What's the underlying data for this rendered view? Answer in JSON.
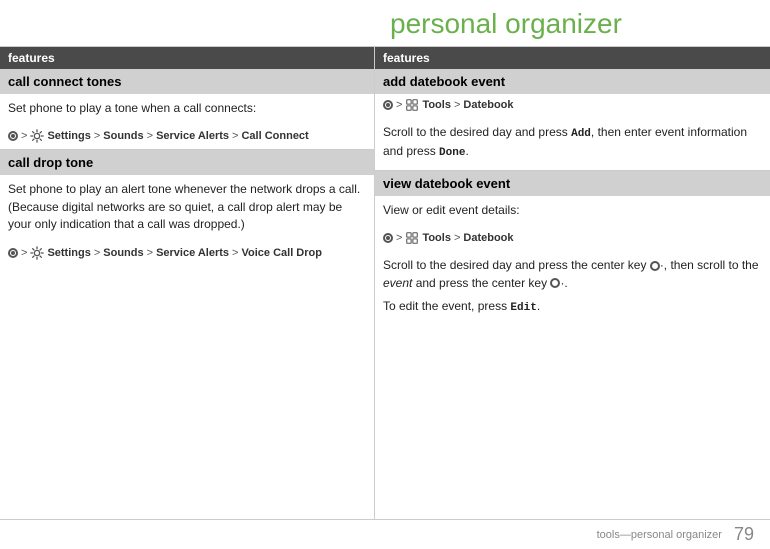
{
  "page": {
    "title": "personal organizer",
    "footer_text": "tools—personal organizer",
    "page_number": "79"
  },
  "left_panel": {
    "header": "features",
    "sections": [
      {
        "id": "call-connect-tones",
        "title": "call connect tones",
        "content": "Set phone to play a tone when a call connects:",
        "nav_path": "· > Settings > Sounds > Service Alerts > Call Connect"
      },
      {
        "id": "call-drop-tone",
        "title": "call drop tone",
        "content": "Set phone to play an alert tone whenever the network drops a call. (Because digital networks are so quiet, a call drop alert may be your only indication that a call was dropped.)",
        "nav_path": "· > Settings > Sounds > Service Alerts > Voice Call Drop"
      }
    ]
  },
  "right_panel": {
    "header": "features",
    "sections": [
      {
        "id": "add-datebook-event",
        "title": "add datebook event",
        "nav_path": "· > Tools > Datebook",
        "content": "Scroll to the desired day and press Add, then enter event information and press Done."
      },
      {
        "id": "view-datebook-event",
        "title": "view datebook event",
        "intro": "View or edit event details:",
        "nav_path": "· > Tools > Datebook",
        "content1": "Scroll to the desired day and press the center key ·, then scroll to the",
        "content_italic": "event",
        "content2": "and press the center key ·.",
        "content3": "To edit the event, press Edit."
      }
    ]
  }
}
